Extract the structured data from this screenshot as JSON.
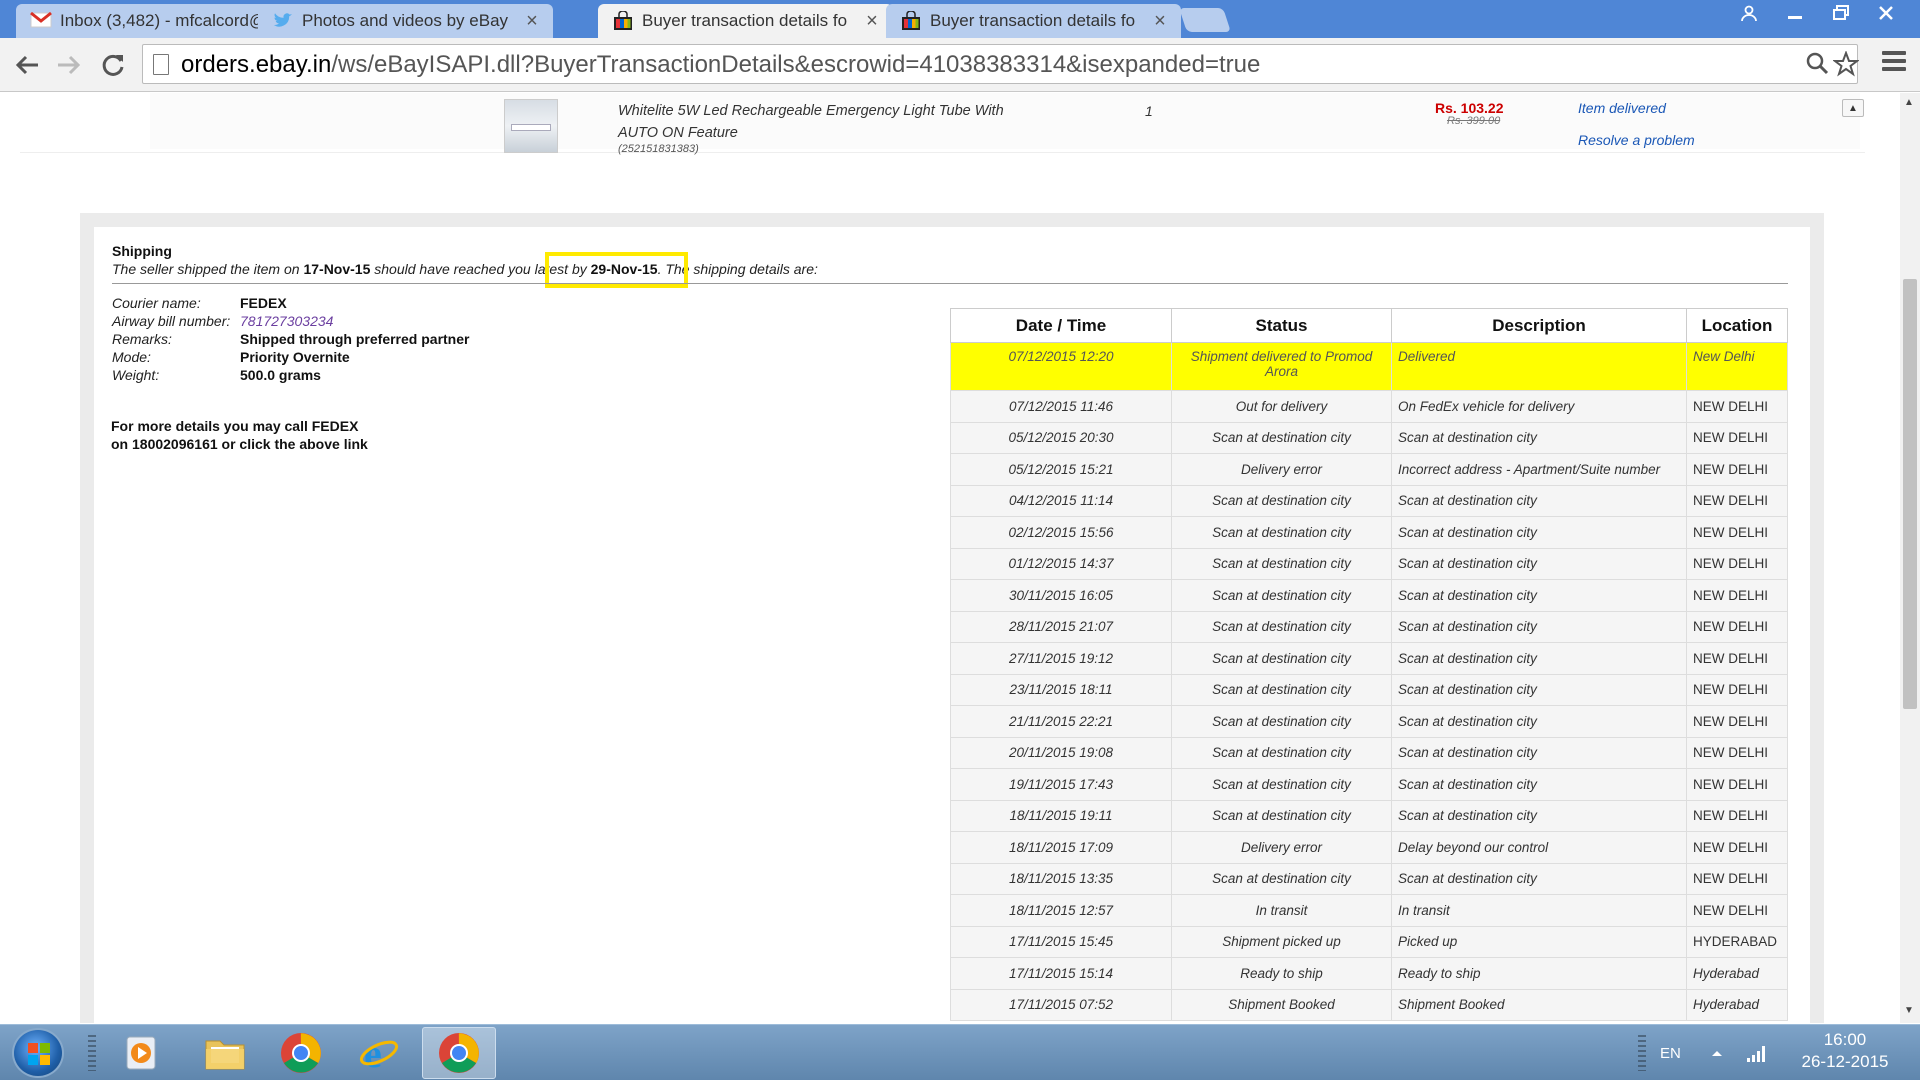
{
  "browser": {
    "tabs": [
      {
        "title": "Inbox (3,482) - mfcalcord@",
        "icon": "gmail-icon"
      },
      {
        "title": "Photos and videos by eBay",
        "icon": "twitter-icon"
      },
      {
        "title": "Buyer transaction details fo",
        "icon": "ebay-icon"
      },
      {
        "title": "Buyer transaction details fo",
        "icon": "ebay-icon"
      }
    ],
    "url_host": "orders.ebay.in",
    "url_path": "/ws/eBayISAPI.dll?BuyerTransactionDetails&escrowid=41038383314&isexpanded=true"
  },
  "item": {
    "title": "Whitelite 5W Led Rechargeable Emergency Light Tube With AUTO ON Feature",
    "id": "(252151831383)",
    "qty": "1",
    "price": "Rs. 103.22",
    "old_price": "Rs. 399.00",
    "status_link": "Item delivered",
    "resolve_link": "Resolve a problem"
  },
  "shipping": {
    "heading": "Shipping",
    "line_a": "The seller shipped the item on ",
    "ship_date": "17-Nov-15",
    "line_b": " should have reached you ",
    "line_c": "latest by ",
    "latest_date": "29-Nov-15",
    "line_d": ". The shipping details are:",
    "fields": [
      {
        "label": "Courier name:",
        "value": "FEDEX"
      },
      {
        "label": "Airway bill number:",
        "value": "781727303234"
      },
      {
        "label": "Remarks:",
        "value": "Shipped through preferred partner"
      },
      {
        "label": "Mode:",
        "value": "Priority Overnite"
      },
      {
        "label": "Weight:",
        "value": "500.0 grams"
      }
    ],
    "more_line1": "For more details you may call FEDEX",
    "more_line2": "on 18002096161 or click the above link"
  },
  "tracking": {
    "headers": [
      "Date / Time",
      "Status",
      "Description",
      "Location"
    ],
    "rows": [
      {
        "datetime": "07/12/2015 12:20",
        "status": "Shipment delivered to Promod Arora",
        "description": "Delivered",
        "location": "New Delhi"
      },
      {
        "datetime": "07/12/2015 11:46",
        "status": "Out for delivery",
        "description": "On FedEx vehicle for delivery",
        "location": "NEW DELHI"
      },
      {
        "datetime": "05/12/2015 20:30",
        "status": "Scan at destination city",
        "description": "Scan at destination city",
        "location": "NEW DELHI"
      },
      {
        "datetime": "05/12/2015 15:21",
        "status": "Delivery error",
        "description": "Incorrect address - Apartment/Suite number",
        "location": "NEW DELHI"
      },
      {
        "datetime": "04/12/2015 11:14",
        "status": "Scan at destination city",
        "description": "Scan at destination city",
        "location": "NEW DELHI"
      },
      {
        "datetime": "02/12/2015 15:56",
        "status": "Scan at destination city",
        "description": "Scan at destination city",
        "location": "NEW DELHI"
      },
      {
        "datetime": "01/12/2015 14:37",
        "status": "Scan at destination city",
        "description": "Scan at destination city",
        "location": "NEW DELHI"
      },
      {
        "datetime": "30/11/2015 16:05",
        "status": "Scan at destination city",
        "description": "Scan at destination city",
        "location": "NEW DELHI"
      },
      {
        "datetime": "28/11/2015 21:07",
        "status": "Scan at destination city",
        "description": "Scan at destination city",
        "location": "NEW DELHI"
      },
      {
        "datetime": "27/11/2015 19:12",
        "status": "Scan at destination city",
        "description": "Scan at destination city",
        "location": "NEW DELHI"
      },
      {
        "datetime": "23/11/2015 18:11",
        "status": "Scan at destination city",
        "description": "Scan at destination city",
        "location": "NEW DELHI"
      },
      {
        "datetime": "21/11/2015 22:21",
        "status": "Scan at destination city",
        "description": "Scan at destination city",
        "location": "NEW DELHI"
      },
      {
        "datetime": "20/11/2015 19:08",
        "status": "Scan at destination city",
        "description": "Scan at destination city",
        "location": "NEW DELHI"
      },
      {
        "datetime": "19/11/2015 17:43",
        "status": "Scan at destination city",
        "description": "Scan at destination city",
        "location": "NEW DELHI"
      },
      {
        "datetime": "18/11/2015 19:11",
        "status": "Scan at destination city",
        "description": "Scan at destination city",
        "location": "NEW DELHI"
      },
      {
        "datetime": "18/11/2015 17:09",
        "status": "Delivery error",
        "description": "Delay beyond our control",
        "location": "NEW DELHI"
      },
      {
        "datetime": "18/11/2015 13:35",
        "status": "Scan at destination city",
        "description": "Scan at destination city",
        "location": "NEW DELHI"
      },
      {
        "datetime": "18/11/2015 12:57",
        "status": "In transit",
        "description": "In transit",
        "location": "NEW DELHI"
      },
      {
        "datetime": "17/11/2015 15:45",
        "status": "Shipment picked up",
        "description": "Picked up",
        "location": "HYDERABAD"
      },
      {
        "datetime": "17/11/2015 15:14",
        "status": "Ready to ship",
        "description": "Ready to ship",
        "location": "Hyderabad"
      },
      {
        "datetime": "17/11/2015 07:52",
        "status": "Shipment Booked",
        "description": "Shipment Booked",
        "location": "Hyderabad"
      }
    ]
  },
  "taskbar": {
    "apps": [
      "media-player-icon",
      "file-explorer-icon",
      "chrome-icon",
      "internet-explorer-icon",
      "chrome-icon"
    ],
    "lang": "EN",
    "time": "16:00",
    "date": "26-12-2015"
  },
  "colors": {
    "highlight": "#ffff00",
    "highlight_box": "#ffea00",
    "price": "#cc0000",
    "link": "#1a57b6"
  }
}
